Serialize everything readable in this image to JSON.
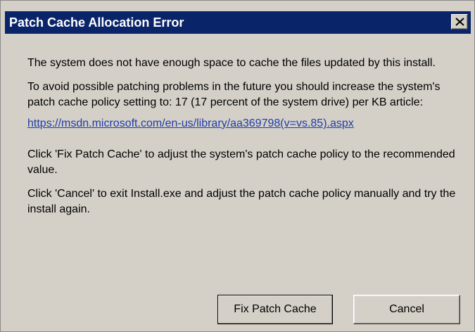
{
  "dialog": {
    "title": "Patch Cache Allocation Error",
    "accent_color": "#0a246a",
    "background_color": "#d4d0c8",
    "close_icon": "close-icon"
  },
  "message": {
    "paragraph_1": "The system does not have enough space to cache the files updated by this install.",
    "paragraph_2": "To avoid possible patching problems in the future you should increase the system's patch cache policy setting to: 17 (17 percent of the system drive) per KB article:",
    "link_text": "https://msdn.microsoft.com/en-us/library/aa369798(v=vs.85).aspx",
    "paragraph_3": "Click 'Fix Patch Cache' to adjust the system's patch cache policy to the recommended value.",
    "paragraph_4": "Click 'Cancel' to exit Install.exe and adjust the patch cache policy manually and try the install again."
  },
  "buttons": {
    "fix_label": "Fix Patch Cache",
    "cancel_label": "Cancel"
  }
}
